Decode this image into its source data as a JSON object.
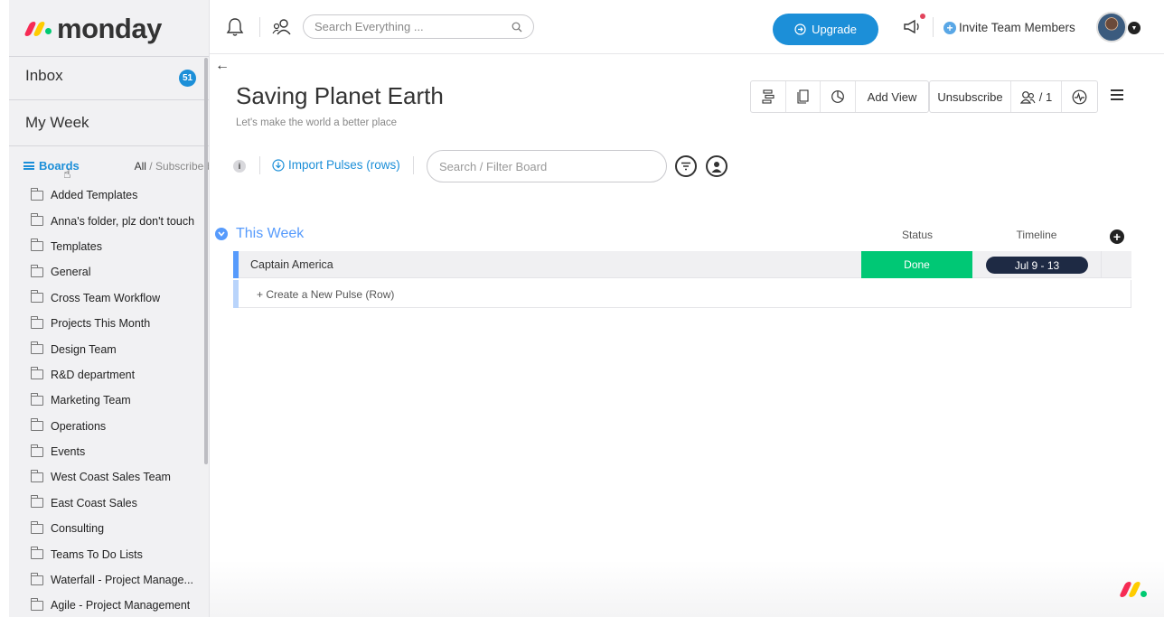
{
  "brand": {
    "name": "monday",
    "colors": {
      "red": "#f62b54",
      "yellow": "#ffcc00",
      "green": "#00ca72",
      "accent": "#1c8fd8",
      "group": "#579bfc",
      "done": "#00c875"
    }
  },
  "topbar": {
    "search_placeholder": "Search Everything ...",
    "upgrade_label": "Upgrade",
    "invite_label": "Invite Team Members"
  },
  "sidebar": {
    "inbox_label": "Inbox",
    "inbox_count": "51",
    "myweek_label": "My Week",
    "boards_label": "Boards",
    "filter_all": "All",
    "filter_sep": " / ",
    "filter_subscribed": "Subscribed",
    "folders": [
      "Added Templates",
      "Anna's folder, plz don't touch",
      "Templates",
      "General",
      "Cross Team Workflow",
      "Projects This Month",
      "Design Team",
      "R&D department",
      "Marketing Team",
      "Operations",
      "Events",
      "West Coast Sales Team",
      "East Coast Sales",
      "Consulting",
      "Teams To Do Lists",
      "Waterfall - Project Manage...",
      "Agile - Project Management"
    ]
  },
  "board": {
    "title": "Saving Planet Earth",
    "description": "Let's make the world a better place",
    "add_view_label": "Add View",
    "unsubscribe_label": "Unsubscribe",
    "subscribers_count": "/ 1",
    "info_label": "i",
    "import_label": "Import Pulses (rows)",
    "filter_placeholder": "Search / Filter Board",
    "group": {
      "title": "This Week",
      "columns": {
        "status": "Status",
        "timeline": "Timeline"
      },
      "rows": [
        {
          "name": "Captain America",
          "status": "Done",
          "timeline": "Jul 9 - 13"
        }
      ],
      "new_row_label": "+ Create a New Pulse (Row)"
    }
  }
}
